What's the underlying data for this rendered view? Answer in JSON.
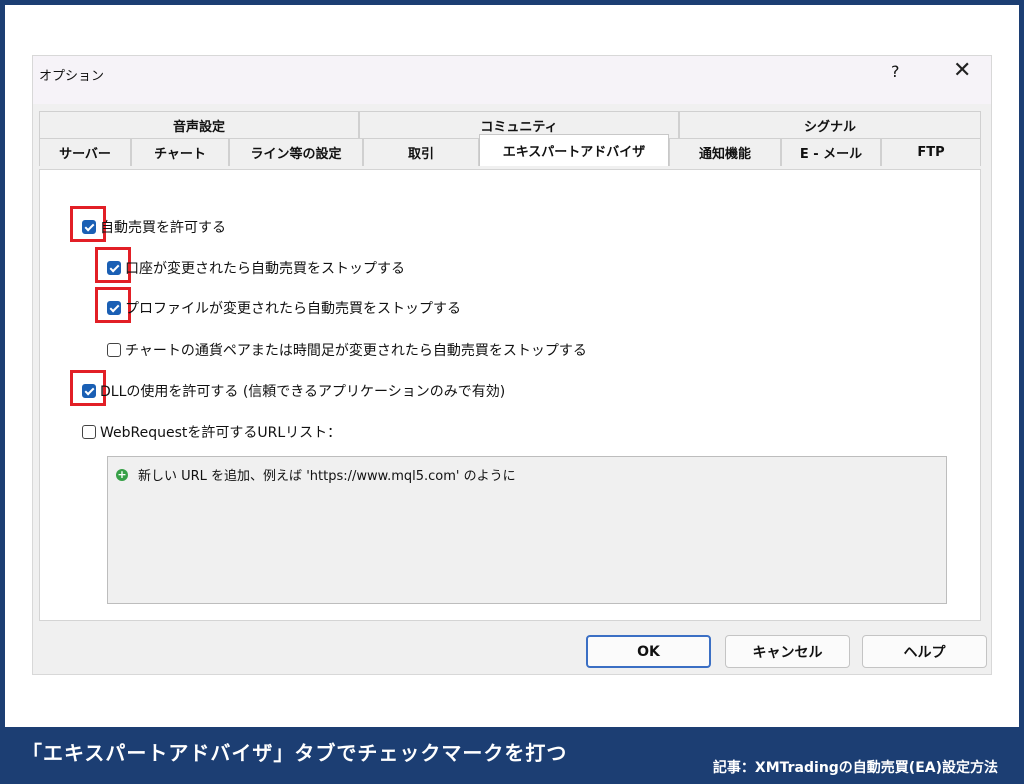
{
  "dialog": {
    "title": "オプション",
    "help": "?",
    "close": "✕"
  },
  "tabs": {
    "row1": [
      "音声設定",
      "コミュニティ",
      "シグナル"
    ],
    "row2": [
      "サーバー",
      "チャート",
      "ライン等の設定",
      "取引",
      "エキスパートアドバイザ",
      "通知機能",
      "E - メール",
      "FTP"
    ],
    "active": "エキスパートアドバイザ"
  },
  "options": {
    "auto_trade": {
      "label": "自動売買を許可する",
      "checked": true
    },
    "stop_account": {
      "label": "口座が変更されたら自動売買をストップする",
      "checked": true
    },
    "stop_profile": {
      "label": "プロファイルが変更されたら自動売買をストップする",
      "checked": true
    },
    "stop_chart": {
      "label": "チャートの通貨ペアまたは時間足が変更されたら自動売買をストップする",
      "checked": false
    },
    "allow_dll": {
      "label": "DLLの使用を許可する (信頼できるアプリケーションのみで有効)",
      "checked": true
    },
    "webrequest": {
      "label": "WebRequestを許可するURLリスト：",
      "checked": false
    }
  },
  "url_list": {
    "add_hint": "新しい URL を追加、例えば 'https://www.mql5.com' のように"
  },
  "buttons": {
    "ok": "OK",
    "cancel": "キャンセル",
    "help": "ヘルプ"
  },
  "footer": {
    "caption": "「エキスパートアドバイザ」タブでチェックマークを打つ",
    "article": "記事：XMTradingの自動売買(EA)設定方法"
  },
  "colors": {
    "brand": "#1c3e73",
    "highlight": "#e21f26",
    "checkbox": "#1a5fb4"
  }
}
